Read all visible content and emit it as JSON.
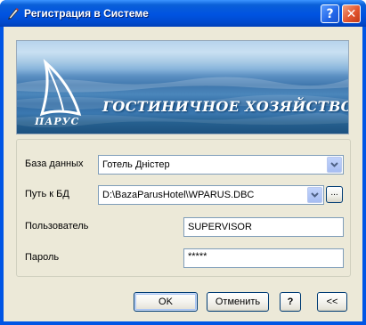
{
  "window": {
    "title": "Регистрация в Системе",
    "help_button": "?",
    "close_button": "✕"
  },
  "banner": {
    "caption": "ГОСТИНИЧНОЕ ХОЗЯЙСТВО",
    "logo_text": "ПАРУС",
    "colors": {
      "sky": "#b7d3ec",
      "sea": "#2f6aa2"
    }
  },
  "form": {
    "database": {
      "label": "База данных",
      "value": "Готель Дністер"
    },
    "db_path": {
      "label": "Путь к БД",
      "value": "D:\\BazaParusHotel\\WPARUS.DBC",
      "browse_label": "..."
    },
    "user": {
      "label": "Пользователь",
      "value": "SUPERVISOR"
    },
    "password": {
      "label": "Пароль",
      "value": "*****"
    }
  },
  "buttons": {
    "ok": "OK",
    "cancel": "Отменить",
    "help": "?",
    "collapse": "<<"
  },
  "icons": {
    "title": "pen-icon",
    "dropdown": "chevron-down-icon",
    "logo": "sail-logo-icon"
  }
}
